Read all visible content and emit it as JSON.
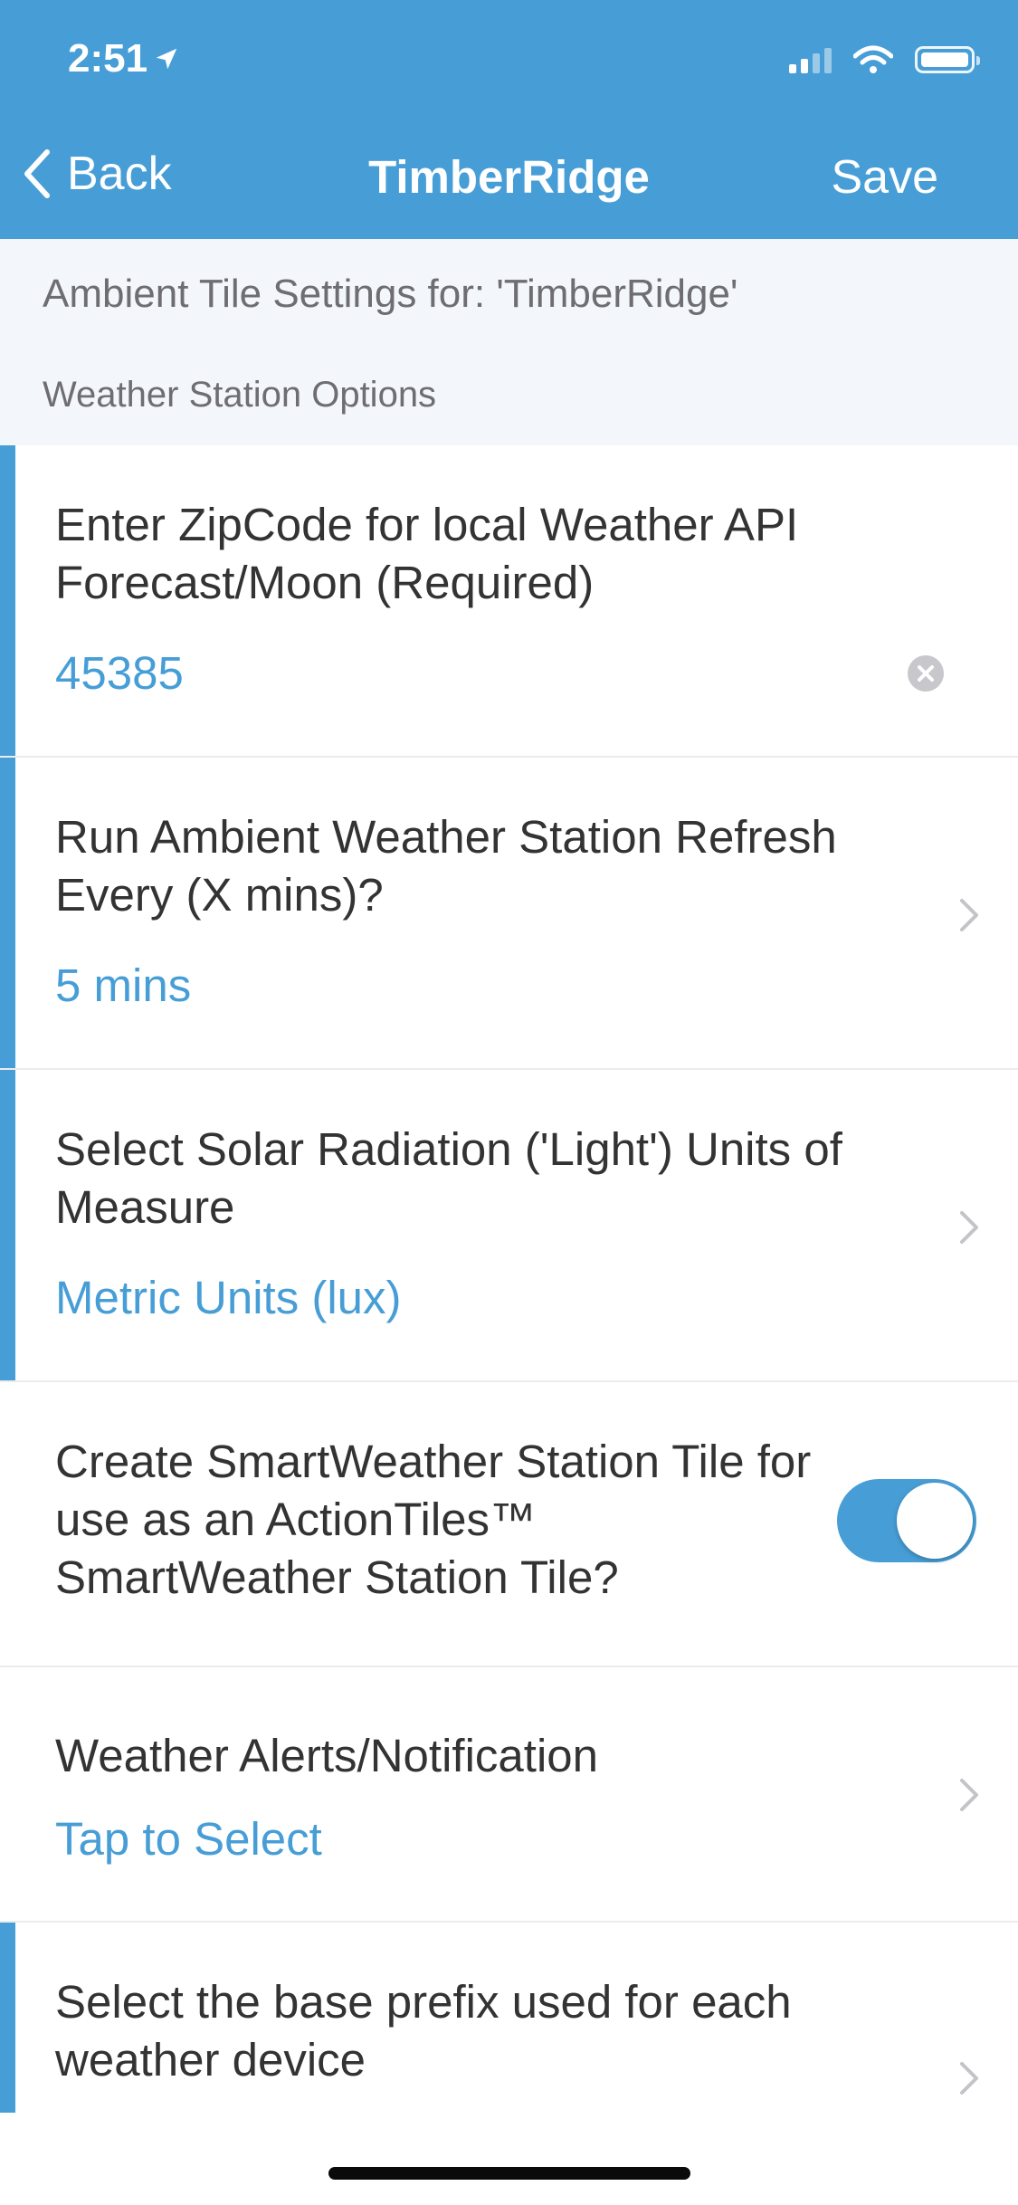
{
  "status_bar": {
    "time": "2:51"
  },
  "nav": {
    "back_label": "Back",
    "title": "TimberRidge",
    "save_label": "Save"
  },
  "subheader": {
    "title": "Ambient Tile Settings for: 'TimberRidge'",
    "section": "Weather Station Options"
  },
  "rows": {
    "zipcode": {
      "label": "Enter ZipCode for local Weather API Forecast/Moon (Required)",
      "value": "45385"
    },
    "refresh": {
      "label": "Run Ambient Weather Station Refresh Every (X mins)?",
      "value": "5 mins"
    },
    "solar": {
      "label": "Select Solar Radiation ('Light') Units of Measure",
      "value": "Metric Units (lux)"
    },
    "smartweather": {
      "label": "Create SmartWeather Station Tile for use as an ActionTiles™ SmartWeather Station Tile?",
      "enabled": true
    },
    "alerts": {
      "label": "Weather Alerts/Notification",
      "value": "Tap to Select"
    },
    "prefix": {
      "label": "Select the base prefix used for each weather device"
    }
  },
  "colors": {
    "accent": "#479ed6",
    "subheader_bg": "#f3f6fb"
  },
  "icons": [
    "location-arrow-icon",
    "signal-icon",
    "wifi-icon",
    "battery-icon",
    "back-chevron-icon",
    "clear-icon",
    "chevron-right-icon"
  ]
}
